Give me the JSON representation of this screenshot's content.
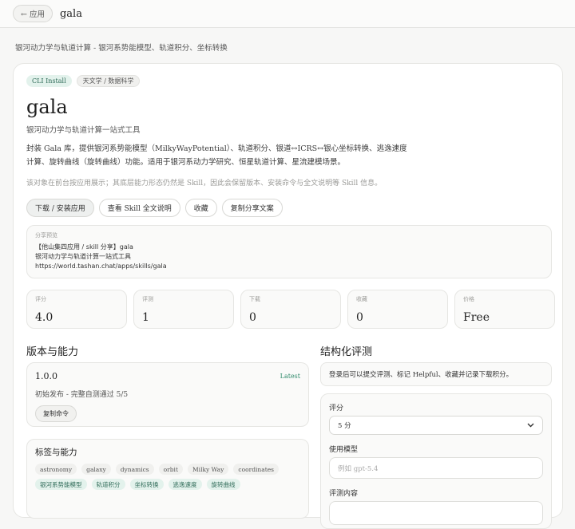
{
  "topbar": {
    "back_label": "← 应用",
    "title": "gala"
  },
  "subtitle": "银河动力学与轨道计算 - 银河系势能模型、轨道积分、坐标转换",
  "app": {
    "badges": [
      {
        "label": "CLI Install",
        "style": "green"
      },
      {
        "label": "天文学 / 数据科学",
        "style": "gray"
      }
    ],
    "name": "gala",
    "tagline": "银河动力学与轨道计算一站式工具",
    "description": "封装 Gala 库，提供银河系势能模型（MilkyWayPotential）、轨道积分、银道↔ICRS↔银心坐标转换、逃逸速度计算、旋转曲线（旋转曲线）功能。适用于银河系动力学研究、恒星轨道计算、星流建模场景。",
    "note": "该对象在前台按应用展示；其底层能力形态仍然是 Skill，因此会保留版本、安装命令与全文说明等 Skill 信息。"
  },
  "actions": [
    "下载 / 安装应用",
    "查看 Skill 全文说明",
    "收藏",
    "复制分享文案"
  ],
  "share": {
    "label": "分享预览",
    "lines": [
      "【他山集四应用 / skill 分享】gala",
      "银河动力学与轨道计算一站式工具",
      "https://world.tashan.chat/apps/skills/gala"
    ]
  },
  "stats": [
    {
      "label": "评分",
      "value": "4.0"
    },
    {
      "label": "评测",
      "value": "1"
    },
    {
      "label": "下载",
      "value": "0"
    },
    {
      "label": "收藏",
      "value": "0"
    },
    {
      "label": "价格",
      "value": "Free"
    }
  ],
  "versions": {
    "title": "版本与能力",
    "version": "1.0.0",
    "latest": "Latest",
    "desc": "初始发布 - 完整自测通过 5/5",
    "copy_cmd": "复制命令"
  },
  "tags": {
    "title": "标签与能力",
    "plain": [
      "astronomy",
      "galaxy",
      "dynamics",
      "orbit",
      "Milky Way",
      "coordinates"
    ],
    "green": [
      "银河系势能模型",
      "轨道积分",
      "坐标转换",
      "逃逸速度",
      "旋转曲线"
    ]
  },
  "review": {
    "title": "结构化评测",
    "login_note": "登录后可以提交评测、标记 Helpful、收藏并记录下载积分。",
    "score_label": "评分",
    "score_value": "5 分",
    "model_label": "使用模型",
    "model_placeholder": "例如 gpt-5.4",
    "content_label": "评测内容"
  }
}
